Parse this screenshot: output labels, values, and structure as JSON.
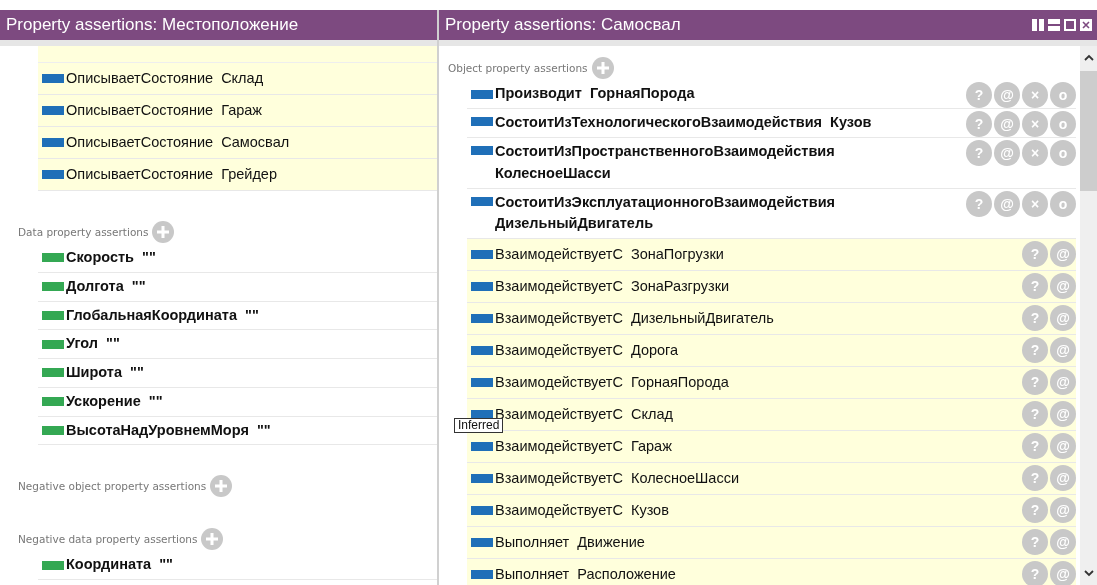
{
  "panels": [
    {
      "title": "Property assertions: Местоположение",
      "window_controls": false,
      "sections": [
        {
          "clipped_top": true,
          "rows": [
            {
              "text": "ОписываетСостояние  Склад",
              "inferred": true,
              "color": "#1f6fb8",
              "buttons": []
            },
            {
              "text": "ОписываетСостояние  Гараж",
              "inferred": true,
              "color": "#1f6fb8",
              "buttons": []
            },
            {
              "text": "ОписываетСостояние  Самосвал",
              "inferred": true,
              "color": "#1f6fb8",
              "buttons": []
            },
            {
              "text": "ОписываетСостояние  Грейдер",
              "inferred": true,
              "color": "#1f6fb8",
              "buttons": []
            }
          ]
        },
        {
          "label": "Data property assertions",
          "rows": [
            {
              "text": "Скорость  \"\"",
              "inferred": false,
              "color": "#34a853",
              "buttons": []
            },
            {
              "text": "Долгота  \"\"",
              "inferred": false,
              "color": "#34a853",
              "buttons": []
            },
            {
              "text": "ГлобальнаяКоордината  \"\"",
              "inferred": false,
              "color": "#34a853",
              "buttons": []
            },
            {
              "text": "Угол  \"\"",
              "inferred": false,
              "color": "#34a853",
              "buttons": []
            },
            {
              "text": "Широта  \"\"",
              "inferred": false,
              "color": "#34a853",
              "buttons": []
            },
            {
              "text": "Ускорение  \"\"",
              "inferred": false,
              "color": "#34a853",
              "buttons": []
            },
            {
              "text": "ВысотаНадУровнемМоря  \"\"",
              "inferred": false,
              "color": "#34a853",
              "buttons": []
            }
          ]
        },
        {
          "label": "Negative object property assertions"
        },
        {
          "label": "Negative data property assertions",
          "rows": [
            {
              "text": "Координата  \"\"",
              "inferred": false,
              "color": "#34a853",
              "buttons": []
            }
          ]
        }
      ]
    },
    {
      "title": "Property assertions: Самосвал",
      "window_controls": true,
      "scrollbar": true,
      "sections": [
        {
          "label": "Object property assertions",
          "rows": [
            {
              "text": "Производит  ГорнаяПорода",
              "inferred": false,
              "color": "#1f6fb8",
              "buttons": [
                "?",
                "@",
                "×",
                "o"
              ]
            },
            {
              "text": "СостоитИзТехнологическогоВзаимодействия  Кузов",
              "inferred": false,
              "color": "#1f6fb8",
              "buttons": [
                "?",
                "@",
                "×",
                "o"
              ]
            },
            {
              "text": "СостоитИзПространственногоВзаимодействия КолесноеШасси",
              "inferred": false,
              "color": "#1f6fb8",
              "buttons": [
                "?",
                "@",
                "×",
                "o"
              ]
            },
            {
              "text": "СостоитИзЭксплуатационногоВзаимодействия ДизельныйДвигатель",
              "inferred": false,
              "color": "#1f6fb8",
              "buttons": [
                "?",
                "@",
                "×",
                "o"
              ]
            },
            {
              "text": "ВзаимодействуетС  ЗонаПогрузки",
              "inferred": true,
              "color": "#1f6fb8",
              "buttons": [
                "?",
                "@"
              ]
            },
            {
              "text": "ВзаимодействуетС  ЗонаРазгрузки",
              "inferred": true,
              "color": "#1f6fb8",
              "buttons": [
                "?",
                "@"
              ]
            },
            {
              "text": "ВзаимодействуетС  ДизельныйДвигатель",
              "inferred": true,
              "color": "#1f6fb8",
              "buttons": [
                "?",
                "@"
              ]
            },
            {
              "text": "ВзаимодействуетС  Дорога",
              "inferred": true,
              "color": "#1f6fb8",
              "buttons": [
                "?",
                "@"
              ]
            },
            {
              "text": "ВзаимодействуетС  ГорнаяПорода",
              "inferred": true,
              "color": "#1f6fb8",
              "buttons": [
                "?",
                "@"
              ]
            },
            {
              "text": "ВзаимодействуетС  Склад",
              "inferred": true,
              "color": "#1f6fb8",
              "buttons": [
                "?",
                "@"
              ]
            },
            {
              "text": "ВзаимодействуетС  Гараж",
              "inferred": true,
              "color": "#1f6fb8",
              "buttons": [
                "?",
                "@"
              ]
            },
            {
              "text": "ВзаимодействуетС  КолесноеШасси",
              "inferred": true,
              "color": "#1f6fb8",
              "buttons": [
                "?",
                "@"
              ]
            },
            {
              "text": "ВзаимодействуетС  Кузов",
              "inferred": true,
              "color": "#1f6fb8",
              "buttons": [
                "?",
                "@"
              ]
            },
            {
              "text": "Выполняет  Движение",
              "inferred": true,
              "color": "#1f6fb8",
              "buttons": [
                "?",
                "@"
              ]
            },
            {
              "text": "Выполняет  Расположение",
              "inferred": true,
              "color": "#1f6fb8",
              "buttons": [
                "?",
                "@"
              ]
            }
          ]
        }
      ]
    }
  ],
  "tooltip": {
    "text": "Inferred"
  }
}
